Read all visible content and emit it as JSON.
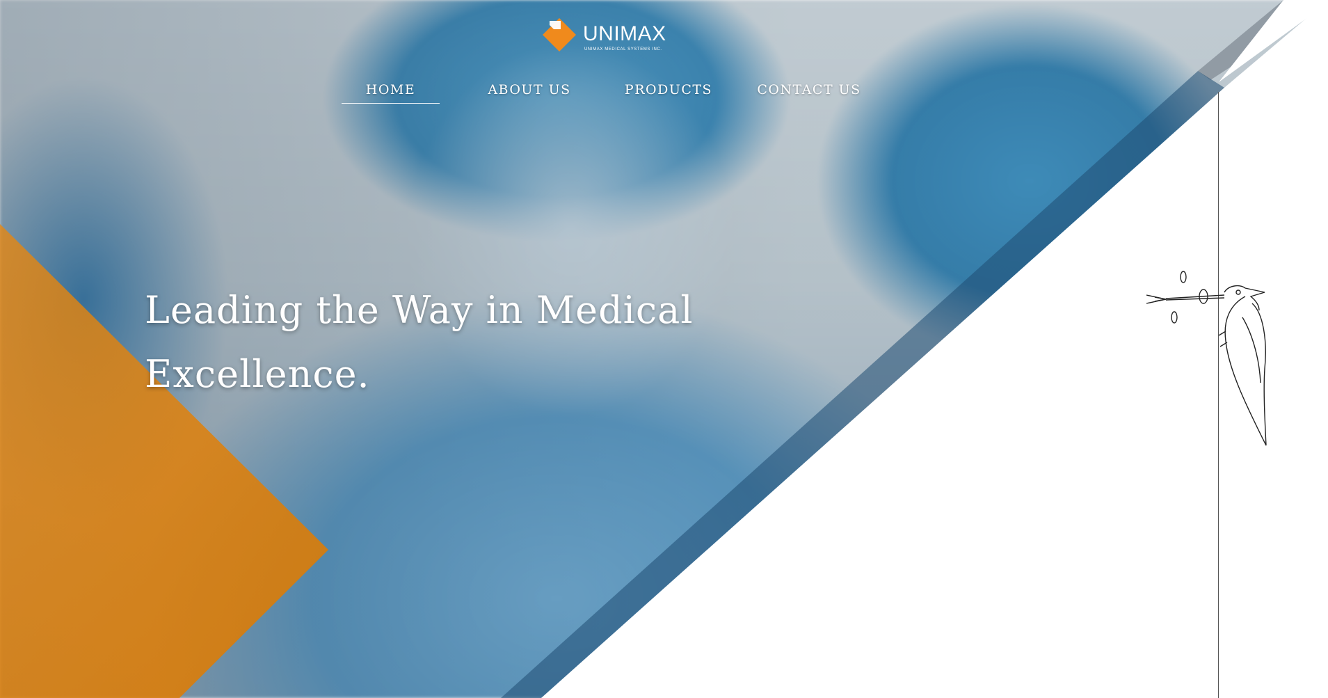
{
  "brand": {
    "name": "UNIMAX",
    "tagline": "UNIMAX MEDICAL SYSTEMS INC.",
    "accent_color": "#f08a1c"
  },
  "nav": {
    "items": [
      {
        "label": "HOME",
        "active": true
      },
      {
        "label": "ABOUT US",
        "active": false
      },
      {
        "label": "PRODUCTS",
        "active": false
      },
      {
        "label": "CONTACT US",
        "active": false
      }
    ]
  },
  "hero": {
    "headline_line1": "Leading the Way in Medical",
    "headline_line2": "Excellence.",
    "orange_color": "#e07e10",
    "diagonal_band_color": "#1f4d73"
  },
  "illustration": {
    "icon": "woodpecker-endoscope-icon"
  }
}
